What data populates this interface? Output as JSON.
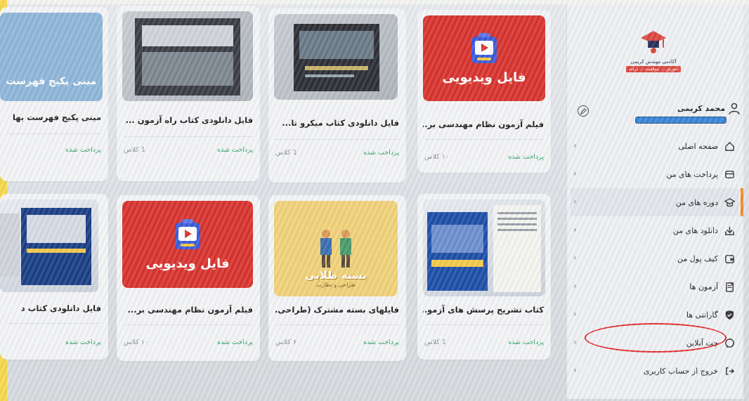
{
  "logo": {
    "title": "آکادمی مهندس کریمی",
    "tagline": "آموزش ... موفقیت ... درآمد"
  },
  "user": {
    "name": "محمد کریمی"
  },
  "menu": [
    {
      "label": "صفحه اصلی",
      "icon": "home-icon"
    },
    {
      "label": "پرداخت های من",
      "icon": "wallet-icon"
    },
    {
      "label": "دوره های من",
      "icon": "graduation-cap-icon",
      "active": true
    },
    {
      "label": "دانلود های من",
      "icon": "download-icon"
    },
    {
      "label": "کیف پول من",
      "icon": "purse-icon"
    },
    {
      "label": "آزمون ها",
      "icon": "exam-icon"
    },
    {
      "label": "گارانتی ها",
      "icon": "shield-icon"
    },
    {
      "label": "چت آنلاین",
      "icon": "chat-icon"
    },
    {
      "label": "خروج از حساب کاربری",
      "icon": "logout-icon"
    }
  ],
  "cards": [
    {
      "title": "فیلم آزمون نظام مهندسی بر...",
      "status": "پرداخت شده",
      "classes": "۱۰ کلاس",
      "thumb_text": "فایل ویدیویی"
    },
    {
      "title": "فایل دانلودی کتاب میکرو تا...",
      "status": "پرداخت شده",
      "classes": "1 کلاس"
    },
    {
      "title": "فایل دانلودی کتاب راه آزمون ...",
      "status": "پرداخت شده",
      "classes": "1 کلاس"
    },
    {
      "title": "مینی پکیج فهرست بها",
      "status": "پرداخت شده",
      "classes": "",
      "thumb_text": "مینی پکیج فهرست"
    },
    {
      "title": "کتاب تشریح پرسش های آزمو...",
      "status": "پرداخت شده",
      "classes": "1 کلاس"
    },
    {
      "title": "فایلهای بسته مشترک (طراحی...",
      "status": "پرداخت شده",
      "classes": "۶ کلاس",
      "thumb_text": "بسته طلایی",
      "thumb_sub": "طراحی و نظارت"
    },
    {
      "title": "فیلم آزمون نظام مهندسی بر...",
      "status": "پرداخت شده",
      "classes": "۱۰ کلاس",
      "thumb_text": "فایل ویدیویی"
    },
    {
      "title": "فایل دانلودی کتاب د",
      "status": "پرداخت شده",
      "classes": ""
    }
  ],
  "colors": {
    "accent": "#f08a24",
    "paid": "#2fa56a",
    "highlight": "#e22b2b",
    "video_red": "#d8342f"
  }
}
